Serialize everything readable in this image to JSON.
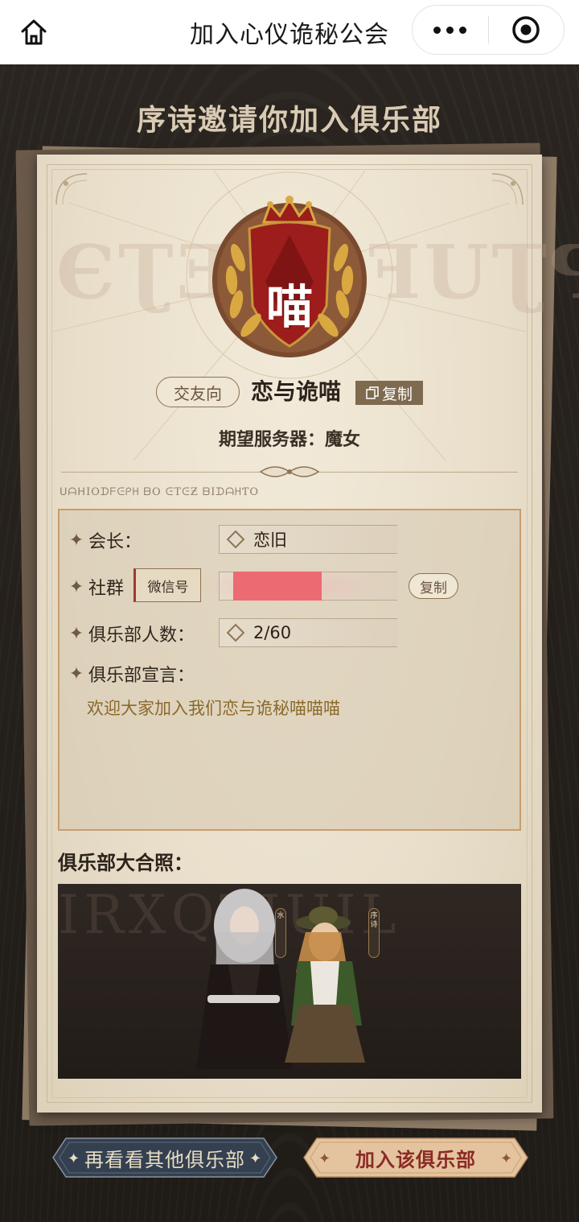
{
  "nav": {
    "title": "加入心仪诡秘公会",
    "home_icon": "home-icon",
    "more_icon": "more-dots-icon",
    "close_icon": "target-icon"
  },
  "invite_title": "序诗邀请你加入俱乐部",
  "emblem": {
    "char": "喵"
  },
  "club": {
    "tag": "交友向",
    "name": "恋与诡喵",
    "copy_label": "复制",
    "server_label": "期望服务器：魔女"
  },
  "info": {
    "leader_label": "会长：",
    "leader_value": "恋旧",
    "community_label": "社群",
    "wechat_label": "微信号",
    "community_copy": "复制",
    "members_label": "俱乐部人数：",
    "members_value": "2/60",
    "declaration_label": "俱乐部宣言：",
    "declaration_text": "欢迎大家加入我们恋与诡秘喵喵喵"
  },
  "photo": {
    "label": "俱乐部大合照：",
    "tag_left": "水",
    "tag_right": "序诗"
  },
  "buttons": {
    "other": "再看看其他俱乐部",
    "join": "加入该俱乐部"
  },
  "colors": {
    "background": "#24201c",
    "paper": "#ece3d0",
    "accent_red": "#8b2a26",
    "accent_gold": "#c79e6e"
  }
}
